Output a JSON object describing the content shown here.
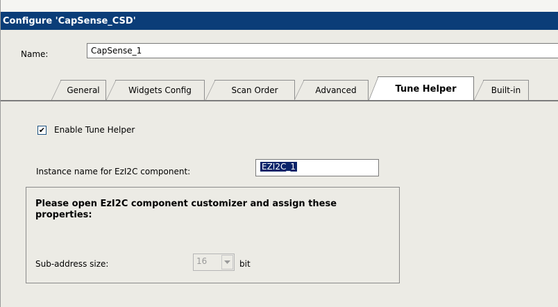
{
  "window": {
    "title": "Configure 'CapSense_CSD'"
  },
  "name_field": {
    "label": "Name:",
    "value": "CapSense_1"
  },
  "tabs": [
    {
      "label": "General"
    },
    {
      "label": "Widgets Config"
    },
    {
      "label": "Scan Order"
    },
    {
      "label": "Advanced"
    },
    {
      "label": "Tune Helper"
    },
    {
      "label": "Built-in"
    }
  ],
  "tune_helper": {
    "enable_checkbox": {
      "label": "Enable Tune Helper",
      "checked": true,
      "mark": "✔"
    },
    "instance": {
      "label": "Instance name for EzI2C component:",
      "value": "EZI2C_1"
    },
    "group": {
      "title": "Please open EzI2C component customizer and assign these properties:",
      "sub_address": {
        "label": "Sub-address size:",
        "value": "16",
        "unit": "bit"
      }
    }
  }
}
